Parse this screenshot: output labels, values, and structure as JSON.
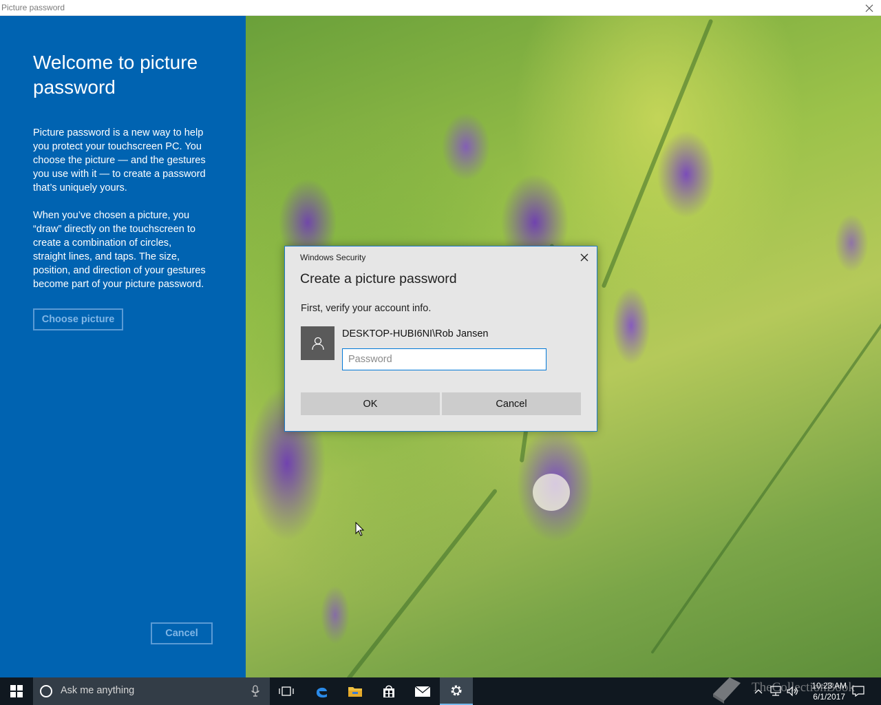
{
  "window": {
    "title": "Picture password"
  },
  "left_panel": {
    "heading": "Welcome to picture password",
    "paragraph1": "Picture password is a new way to help you protect your touchscreen PC. You choose the picture — and the gestures you use with it — to create a password that’s uniquely yours.",
    "paragraph2": "When you’ve chosen a picture, you “draw” directly on the touchscreen to create a combination of circles, straight lines, and taps. The size, position, and direction of your gestures become part of your picture password.",
    "choose_picture_label": "Choose picture",
    "cancel_label": "Cancel"
  },
  "dialog": {
    "window_title": "Windows Security",
    "heading": "Create a picture password",
    "subtext": "First, verify your account info.",
    "account_name": "DESKTOP-HUBI6NI\\Rob Jansen",
    "password_placeholder": "Password",
    "password_value": "",
    "ok_label": "OK",
    "cancel_label": "Cancel"
  },
  "taskbar": {
    "search_placeholder": "Ask me anything",
    "time": "10:23 AM",
    "date": "6/1/2017",
    "watermark": "TheCollectionBook"
  },
  "colors": {
    "accent": "#0063b1",
    "dialog_border": "#1979ca",
    "taskbar": "#101820"
  }
}
